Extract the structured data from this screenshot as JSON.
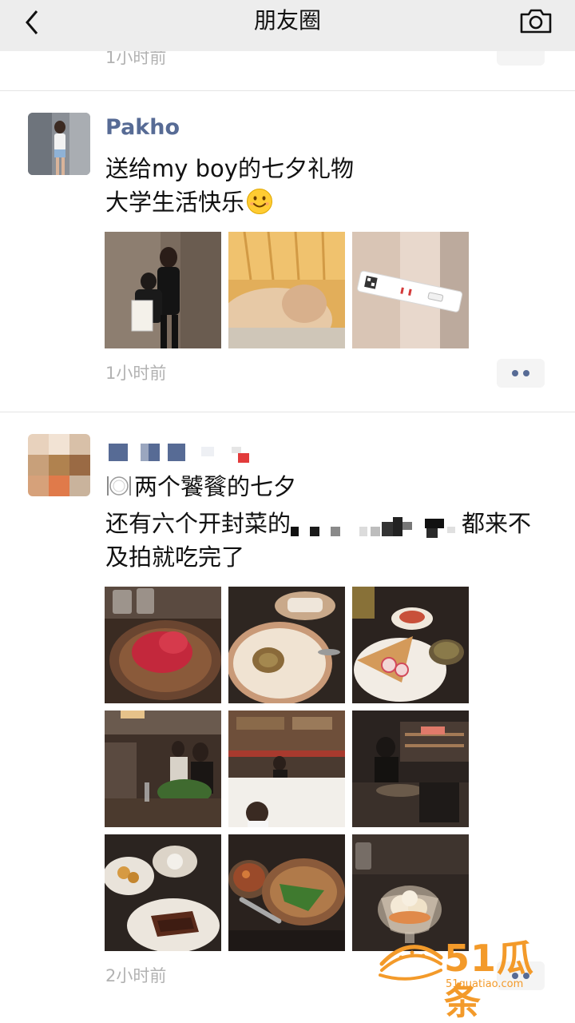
{
  "navbar": {
    "title": "朋友圈",
    "back_icon": "chevron-left-icon",
    "camera_icon": "camera-icon"
  },
  "previous_post": {
    "time": "1小时前"
  },
  "posts": [
    {
      "username": "Pakho",
      "text_line1": "送给my boy的七夕礼物",
      "text_line2": "大学生活快乐",
      "text_emoji": "smiling-face-emoji",
      "time": "1小时前",
      "image_count": 3
    },
    {
      "username": "",
      "text_line1": "两个饕餮的七夕",
      "text_line1_emoji": "plate-cutlery-emoji",
      "text_line2_a": "还有六个开封菜的",
      "text_line2_b": "都来不",
      "text_line3": "及拍就吃完了",
      "time": "2小时前",
      "image_count": 9
    }
  ],
  "watermark": {
    "text": "51瓜条",
    "url": "51guatiao.com"
  },
  "colors": {
    "navbar_bg": "#ededed",
    "username": "#576b95",
    "time": "#b2b2b2",
    "watermark": "#f39a2a"
  }
}
